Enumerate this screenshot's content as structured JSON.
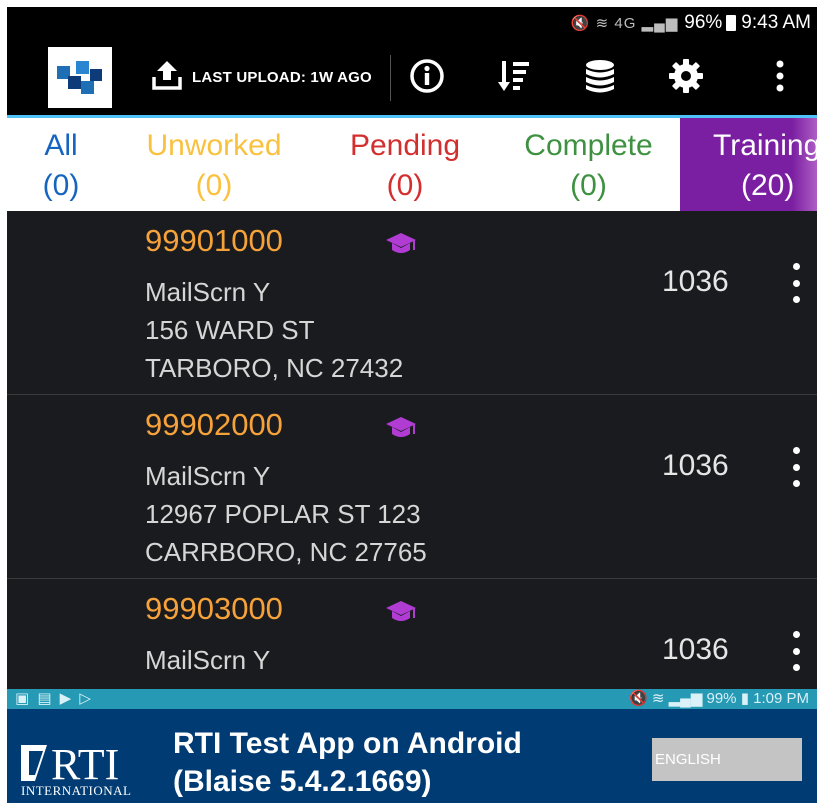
{
  "status_bar": {
    "battery": "96%",
    "time": "9:43 AM",
    "signal": "4G"
  },
  "toolbar": {
    "upload_label": "LAST UPLOAD: 1W AGO"
  },
  "tabs": [
    {
      "label": "All",
      "count": "(0)"
    },
    {
      "label": "Unworked",
      "count": "(0)"
    },
    {
      "label": "Pending",
      "count": "(0)"
    },
    {
      "label": "Complete",
      "count": "(0)"
    },
    {
      "label": "Training",
      "count": "(20)"
    }
  ],
  "cases": [
    {
      "id": "99901000",
      "line1": "MailScrn Y",
      "line2": "156 WARD ST",
      "line3": "TARBORO, NC 27432",
      "number": "1036"
    },
    {
      "id": "99902000",
      "line1": "MailScrn Y",
      "line2": "12967 POPLAR ST 123",
      "line3": "CARRBORO, NC 27765",
      "number": "1036"
    },
    {
      "id": "99903000",
      "line1": "MailScrn Y",
      "line2": "",
      "line3": "",
      "number": "1036"
    }
  ],
  "overlay_status_bar": {
    "battery": "99%",
    "time": "1:09 PM"
  },
  "banner": {
    "logo_text": "RTI",
    "logo_subtext": "INTERNATIONAL",
    "title_line1": "RTI Test App on Android",
    "title_line2": "(Blaise 5.4.2.1669)",
    "language_button": "ENGLISH"
  },
  "colors": {
    "all": "#1565c0",
    "unworked": "#f9c13e",
    "pending": "#d32f2f",
    "complete": "#3f9142",
    "training": "#7b1fa2",
    "case_id": "#f6a23a",
    "banner": "#003b73",
    "accent_line": "#4fc3f7"
  },
  "icons": [
    "app-logo-icon",
    "upload-icon",
    "info-icon",
    "sort-icon",
    "database-icon",
    "gear-icon",
    "overflow-menu-icon",
    "graduation-cap-icon"
  ]
}
